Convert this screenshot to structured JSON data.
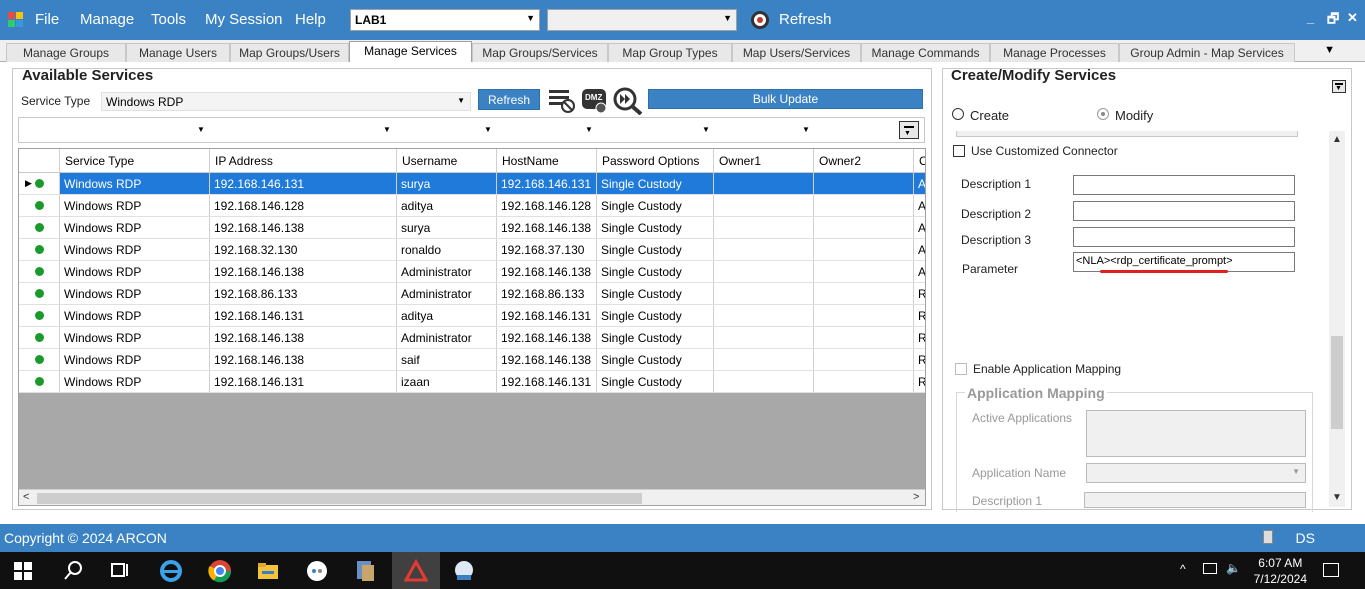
{
  "menubar": {
    "items": [
      "File",
      "Manage",
      "Tools",
      "My Session",
      "Help"
    ],
    "server_combo": "LAB1",
    "second_combo": "",
    "refresh_label": "Refresh"
  },
  "tabs": [
    {
      "label": "Manage Groups",
      "active": false
    },
    {
      "label": "Manage Users",
      "active": false
    },
    {
      "label": "Map Groups/Users",
      "active": false
    },
    {
      "label": "Manage Services",
      "active": true
    },
    {
      "label": "Map Groups/Services",
      "active": false
    },
    {
      "label": "Map Group Types",
      "active": false
    },
    {
      "label": "Map Users/Services",
      "active": false
    },
    {
      "label": "Manage Commands",
      "active": false
    },
    {
      "label": "Manage Processes",
      "active": false
    },
    {
      "label": "Group Admin - Map Services",
      "active": false
    }
  ],
  "available_services": {
    "title": "Available Services",
    "service_type_label": "Service Type",
    "service_type_value": "Windows RDP",
    "refresh_button": "Refresh",
    "bulk_update_button": "Bulk Update",
    "dmz_icon_text": "DMZ",
    "columns": [
      "Service Type",
      "IP Address",
      "Username",
      "HostName",
      "Password Options",
      "Owner1",
      "Owner2",
      "C"
    ],
    "rows": [
      {
        "service_type": "Windows RDP",
        "ip": "192.168.146.131",
        "username": "surya",
        "hostname": "192.168.146.131",
        "password_option": "Single Custody",
        "owner1": "",
        "owner2": "",
        "c": "Al",
        "selected": true
      },
      {
        "service_type": "Windows RDP",
        "ip": "192.168.146.128",
        "username": "aditya",
        "hostname": "192.168.146.128",
        "password_option": "Single Custody",
        "owner1": "",
        "owner2": "",
        "c": "Al",
        "selected": false
      },
      {
        "service_type": "Windows RDP",
        "ip": "192.168.146.138",
        "username": "surya",
        "hostname": "192.168.146.138",
        "password_option": "Single Custody",
        "owner1": "",
        "owner2": "",
        "c": "Al",
        "selected": false
      },
      {
        "service_type": "Windows RDP",
        "ip": "192.168.32.130",
        "username": "ronaldo",
        "hostname": "192.168.37.130",
        "password_option": "Single Custody",
        "owner1": "",
        "owner2": "",
        "c": "Al",
        "selected": false
      },
      {
        "service_type": "Windows RDP",
        "ip": "192.168.146.138",
        "username": "Administrator",
        "hostname": "192.168.146.138",
        "password_option": "Single Custody",
        "owner1": "",
        "owner2": "",
        "c": "Al",
        "selected": false
      },
      {
        "service_type": "Windows RDP",
        "ip": "192.168.86.133",
        "username": "Administrator",
        "hostname": "192.168.86.133",
        "password_option": "Single Custody",
        "owner1": "",
        "owner2": "",
        "c": "R",
        "selected": false
      },
      {
        "service_type": "Windows RDP",
        "ip": "192.168.146.131",
        "username": "aditya",
        "hostname": "192.168.146.131",
        "password_option": "Single Custody",
        "owner1": "",
        "owner2": "",
        "c": "R",
        "selected": false
      },
      {
        "service_type": "Windows RDP",
        "ip": "192.168.146.138",
        "username": "Administrator",
        "hostname": "192.168.146.138",
        "password_option": "Single Custody",
        "owner1": "",
        "owner2": "",
        "c": "R",
        "selected": false
      },
      {
        "service_type": "Windows RDP",
        "ip": "192.168.146.138",
        "username": "saif",
        "hostname": "192.168.146.138",
        "password_option": "Single Custody",
        "owner1": "",
        "owner2": "",
        "c": "R",
        "selected": false
      },
      {
        "service_type": "Windows RDP",
        "ip": "192.168.146.131",
        "username": "izaan",
        "hostname": "192.168.146.131",
        "password_option": "Single Custody",
        "owner1": "",
        "owner2": "",
        "c": "R",
        "selected": false
      }
    ]
  },
  "create_modify": {
    "title": "Create/Modify Services",
    "create_label": "Create",
    "modify_label": "Modify",
    "use_custom_connector_label": "Use Customized Connector",
    "description1_label": "Description 1",
    "description1_value": "",
    "description2_label": "Description 2",
    "description2_value": "",
    "description3_label": "Description 3",
    "description3_value": "",
    "parameter_label": "Parameter",
    "parameter_value": "<NLA><rdp_certificate_prompt>",
    "enable_app_mapping_label": "Enable Application Mapping",
    "app_mapping_title": "Application Mapping",
    "active_applications_label": "Active Applications",
    "application_name_label": "Application Name",
    "app_description1_label": "Description 1"
  },
  "statusbar": {
    "copyright": "Copyright © 2024 ARCON",
    "ds": "DS"
  },
  "taskbar": {
    "time": "6:07 AM",
    "date": "7/12/2024"
  },
  "colors": {
    "accent": "#3a82c4",
    "selection": "#1f7ad9",
    "status_dot": "#1a9a2a"
  }
}
